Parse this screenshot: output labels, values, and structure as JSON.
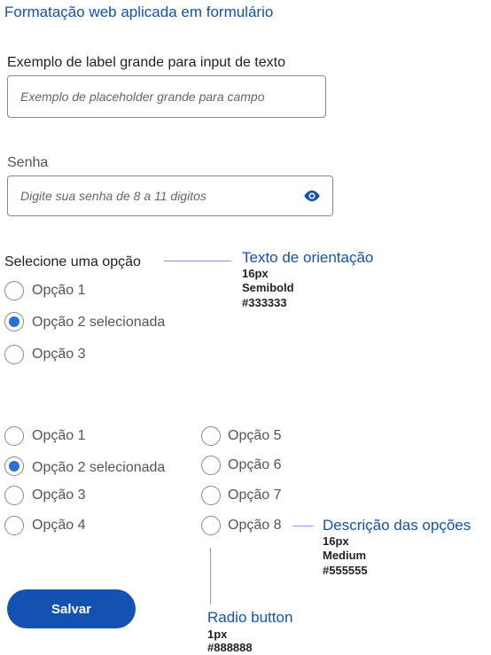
{
  "page": {
    "title": "Formatação web aplicada em formulário"
  },
  "form": {
    "text_field": {
      "label": "Exemplo de label grande para input de texto",
      "placeholder": "Exemplo de placeholder grande para campo"
    },
    "password_field": {
      "label": "Senha",
      "placeholder": "Digite sua senha de 8 a 11 digitos",
      "icon": "eye-icon"
    },
    "radio_group_1": {
      "label": "Selecione uma opção",
      "options": [
        {
          "label": "Opção 1",
          "checked": false
        },
        {
          "label": "Opção 2 selecionada",
          "checked": true
        },
        {
          "label": "Opção 3",
          "checked": false
        }
      ]
    },
    "radio_group_2": {
      "col1": [
        {
          "label": "Opção 1",
          "checked": false
        },
        {
          "label": "Opção 2 selecionada",
          "checked": true
        },
        {
          "label": "Opção 3",
          "checked": false
        },
        {
          "label": "Opção 4",
          "checked": false
        }
      ],
      "col2": [
        {
          "label": "Opção 5",
          "checked": false
        },
        {
          "label": "Opção 6",
          "checked": false
        },
        {
          "label": "Opção 7",
          "checked": false
        },
        {
          "label": "Opção 8",
          "checked": false
        }
      ]
    },
    "save_label": "Salvar"
  },
  "annotations": {
    "orientation": {
      "title": "Texto de orientação",
      "lines": [
        "16px",
        "Semibold",
        " #333333"
      ]
    },
    "options_desc": {
      "title": "Descrição das opções",
      "lines": [
        "16px",
        "Medium",
        "#555555"
      ]
    },
    "radio_button": {
      "title": "Radio button",
      "lines": [
        "1px",
        "#888888"
      ]
    }
  },
  "colors": {
    "accent": "#1352b1",
    "radio_checked": "#2b6fd6",
    "border": "#888888",
    "text": "#333333",
    "muted": "#555555"
  }
}
